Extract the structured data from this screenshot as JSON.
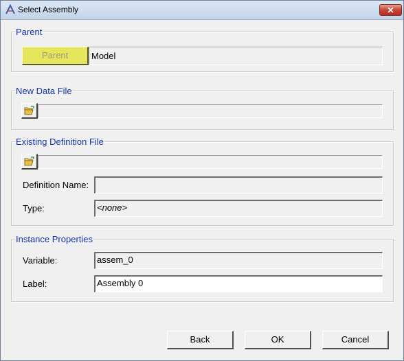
{
  "window": {
    "title": "Select Assembly",
    "close_label": "✕"
  },
  "parent_group": {
    "legend": "Parent",
    "button_label": "Parent",
    "value": "Model"
  },
  "new_data_file": {
    "legend": "New Data File",
    "path": ""
  },
  "existing_definition": {
    "legend": "Existing Definition File",
    "path": "",
    "definition_name_label": "Definition Name:",
    "definition_name_value": "",
    "type_label": "Type:",
    "type_value": "<none>"
  },
  "instance_properties": {
    "legend": "Instance Properties",
    "variable_label": "Variable:",
    "variable_value": "assem_0",
    "label_label": "Label:",
    "label_value": "Assembly 0"
  },
  "buttons": {
    "back": "Back",
    "ok": "OK",
    "cancel": "Cancel"
  },
  "colors": {
    "legend": "#1030b0",
    "parent_button": "#e6e65c",
    "title_bar": "#c3d4ea"
  }
}
